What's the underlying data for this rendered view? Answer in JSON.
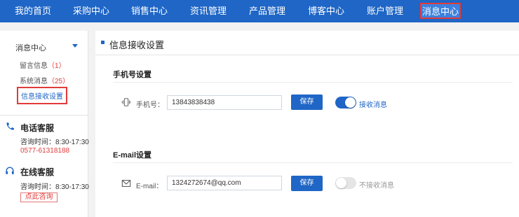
{
  "nav": {
    "items": [
      "我的首页",
      "采购中心",
      "销售中心",
      "资讯管理",
      "产品管理",
      "博客中心",
      "账户管理",
      "消息中心"
    ],
    "active_index": 7,
    "bg_color": "#1f66c6"
  },
  "sidebar": {
    "header": "消息中心",
    "links": [
      {
        "label": "留言信息",
        "count": "1"
      },
      {
        "label": "系统消息",
        "count": "25"
      },
      {
        "label": "信息接收设置",
        "count": ""
      }
    ],
    "phone_service": {
      "title": "电话客服",
      "hours": "咨询时间：8:30-17:30",
      "phone": "0577-61318188",
      "icon": "phone-icon"
    },
    "online_service": {
      "title": "在线客服",
      "hours": "咨询时间：8:30-17:30",
      "button": "点此咨询",
      "icon": "headset-icon"
    }
  },
  "main": {
    "title": "信息接收设置",
    "phone_section": {
      "title": "手机号设置",
      "label": "手机号：",
      "value": "13843838438",
      "save": "保存",
      "toggle_on": true,
      "toggle_label": "接收消息",
      "icon": "phone-vibrate-icon"
    },
    "email_section": {
      "title": "E-mail设置",
      "label": "E-mail：",
      "value": "1324272674@qq.com",
      "save": "保存",
      "toggle_on": false,
      "toggle_label": "不接收消息",
      "icon": "envelope-icon"
    }
  },
  "colors": {
    "accent": "#1f66c6",
    "highlight_border": "#e23b3b",
    "count_red": "#e23b3b"
  }
}
